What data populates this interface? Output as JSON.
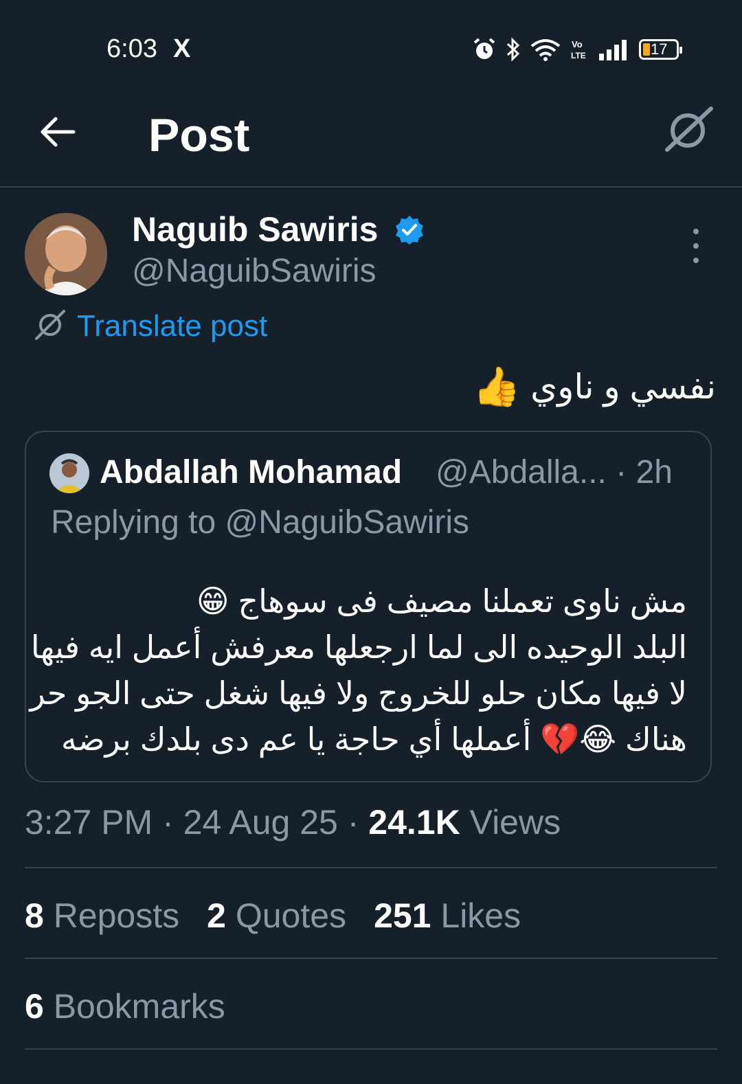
{
  "status_bar": {
    "time": "6:03",
    "app_icon": "X",
    "battery_level": "17",
    "icons": [
      "alarm-icon",
      "bluetooth-icon",
      "wifi-icon",
      "volte-icon",
      "signal-icon",
      "battery-icon"
    ]
  },
  "header": {
    "title": "Post"
  },
  "post": {
    "author_name": "Naguib Sawiris",
    "author_handle": "@NaguibSawiris",
    "translate_label": "Translate post",
    "text": "نفسي و ناوي",
    "emoji": "👍",
    "timestamp": "3:27 PM · 24 Aug 25 · ",
    "views_count": "24.1K",
    "views_label": " Views",
    "reposts_count": "8",
    "reposts_label": " Reposts",
    "quotes_count": "2",
    "quotes_label": " Quotes",
    "likes_count": "251",
    "likes_label": " Likes",
    "bookmarks_count": "6",
    "bookmarks_label": " Bookmarks"
  },
  "quoted_post": {
    "author_name": "Abdallah Mohamad",
    "author_handle": "@Abdalla... · 2h",
    "replying_to": "Replying to @NaguibSawiris",
    "lines": [
      "مش ناوى تعملنا مصيف فى سوهاج 😁",
      "البلد الوحيده الى لما ارجعلها معرفش أعمل ايه فيها",
      "لا فيها مكان حلو للخروج ولا فيها شغل حتى الجو حر",
      "هناك 😂💔 أعملها أي حاجة يا عم دى بلدك برضه"
    ]
  },
  "colors": {
    "background": "#15202b",
    "text_primary": "#ffffff",
    "text_secondary": "#8b98a5",
    "accent": "#1d9bf0",
    "divider": "#38444d"
  }
}
